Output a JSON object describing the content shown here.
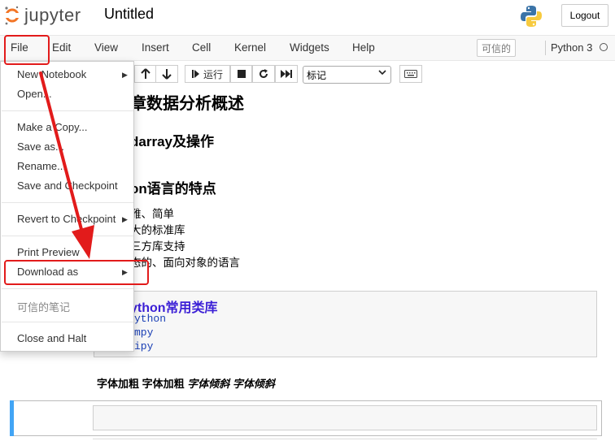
{
  "header": {
    "logo_text": "jupyter",
    "notebook_title": "Untitled",
    "logout_label": "Logout"
  },
  "menubar": {
    "items": [
      "File",
      "Edit",
      "View",
      "Insert",
      "Cell",
      "Kernel",
      "Widgets",
      "Help"
    ],
    "trusted_label": "可信的",
    "kernel_name": "Python 3"
  },
  "toolbar": {
    "run_label": "运行",
    "cell_type_value": "标记"
  },
  "file_menu": {
    "items": [
      {
        "label": "New Notebook",
        "submenu": true
      },
      {
        "label": "Open...",
        "submenu": false
      },
      {
        "label": "Make a Copy...",
        "submenu": false
      },
      {
        "label": "Save as...",
        "submenu": false
      },
      {
        "label": "Rename...",
        "submenu": false
      },
      {
        "label": "Save and Checkpoint",
        "submenu": false
      },
      {
        "label": "Revert to Checkpoint",
        "submenu": true
      },
      {
        "label": "Print Preview",
        "submenu": false
      },
      {
        "label": "Download as",
        "submenu": true
      },
      {
        "label": "可信的笔记",
        "submenu": false,
        "disabled": true
      },
      {
        "label": "Close and Halt",
        "submenu": false
      }
    ]
  },
  "notebook": {
    "heading_1": "章数据分析概述",
    "heading_2": "darray及操作",
    "heading_3": "on语言的特点",
    "list_items": [
      "雅、简单",
      "大的标准库",
      "三方库支持",
      "态的、面向对象的语言"
    ],
    "code_heading": "ython常用类库",
    "code_lines": [
      "ython",
      "mpy",
      "ipy"
    ],
    "rich_text_bold": "字体加粗 字体加粗",
    "rich_text_italic": "字体倾斜 字体倾斜"
  },
  "colors": {
    "annotation_red": "#e21b1b",
    "selected_cell_bar": "#42a5f5",
    "jupyter_orange": "#f37626"
  }
}
